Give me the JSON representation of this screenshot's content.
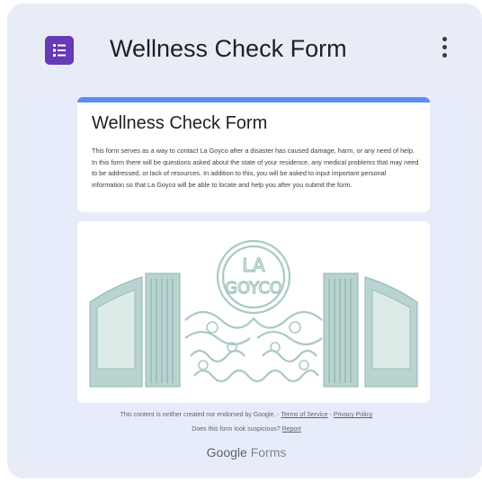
{
  "card": {
    "title": "Wellness Check Form",
    "app_icon": "google-forms-icon",
    "menu_icon": "more-vert-icon"
  },
  "form": {
    "title": "Wellness Check Form",
    "description": "This form serves as a way to contact La Goyco after a disaster has caused damage, harm, or any need of help. In this form there will be questions asked about the state of your residence, any medical problems that may need to be addressed, or lack of resources. In addition to this, you will be asked to input important personal information so that La Goyco will be able to locate and help you after you submit the form.",
    "image_logo_text": "LA GOYCO"
  },
  "footer": {
    "disclaimer": "This content is neither created nor endorsed by Google.",
    "sep1": " - ",
    "terms": "Terms of Service",
    "sep2": " - ",
    "privacy": "Privacy Policy",
    "suspicious": "Does this form look suspicious?",
    "report": "Report",
    "brand_google": "Google",
    "brand_forms": "Forms"
  },
  "colors": {
    "accent": "#5b8ef0",
    "forms_purple": "#673ab7",
    "gate": "#a9c9c6"
  }
}
